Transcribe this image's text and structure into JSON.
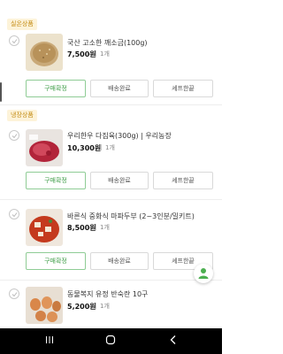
{
  "sections": [
    {
      "label": "실온상품"
    },
    {
      "label": "냉장상품"
    }
  ],
  "products": [
    {
      "name": "국산 고소한 깨소금(100g)",
      "price": "7,500원",
      "qty": "1개"
    },
    {
      "name": "우리한우 다짐육(300g) | 우리농장",
      "price": "10,300원",
      "qty": "1개"
    },
    {
      "name": "바른식 중화식 마파두부 (2~3인분/밀키트)",
      "price": "8,500원",
      "qty": "1개"
    },
    {
      "name": "동물복지 유정 반숙란 10구",
      "price": "5,200원",
      "qty": "1개"
    }
  ],
  "buttons": {
    "confirm": "구매확정",
    "delivered": "배송완료",
    "chef_review": "셰프한끝"
  },
  "colors": {
    "accent_green": "#3f9e48",
    "tag_bg": "#fdf3d9",
    "tag_text": "#c28a10"
  },
  "icons": {
    "check": "check-icon",
    "fab": "chat-person-icon",
    "nav": [
      "recent-apps-icon",
      "home-icon",
      "back-icon"
    ]
  }
}
